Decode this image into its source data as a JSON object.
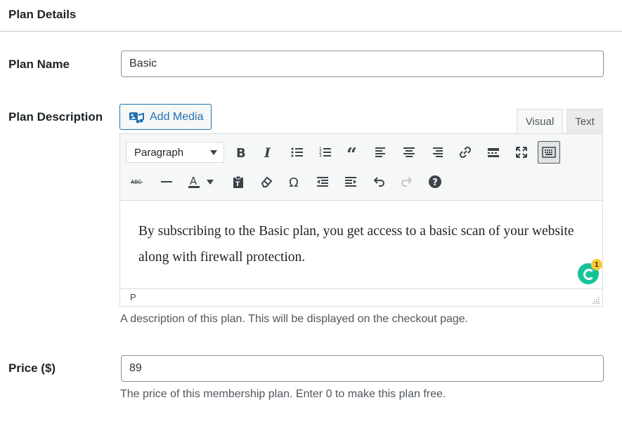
{
  "section": {
    "title": "Plan Details"
  },
  "plan_name": {
    "label": "Plan Name",
    "value": "Basic"
  },
  "plan_description": {
    "label": "Plan Description",
    "add_media_label": "Add Media",
    "tabs": {
      "visual": "Visual",
      "text": "Text"
    },
    "format_select": "Paragraph",
    "content": "By subscribing to the Basic plan, you get access to a basic scan of your website along with firewall protection.",
    "status_path": "P",
    "grammarly_count": "1",
    "help_text": "A description of this plan. This will be displayed on the checkout page."
  },
  "price": {
    "label": "Price ($)",
    "value": "89",
    "help_text": "The price of this membership plan. Enter 0 to make this plan free."
  },
  "toolbar_icons": {
    "row1": [
      "bold-icon",
      "italic-icon",
      "bulleted-list-icon",
      "numbered-list-icon",
      "blockquote-icon",
      "align-left-icon",
      "align-center-icon",
      "align-right-icon",
      "link-icon",
      "read-more-icon",
      "fullscreen-icon",
      "toolbar-toggle-icon"
    ],
    "row2": [
      "strikethrough-icon",
      "horizontal-line-icon",
      "text-color-icon",
      "paste-text-icon",
      "clear-formatting-icon",
      "special-character-icon",
      "outdent-icon",
      "indent-icon",
      "undo-icon",
      "redo-icon",
      "help-icon"
    ]
  },
  "colors": {
    "accent": "#2271b1",
    "grammarly": "#15c39a",
    "badge": "#fcc934"
  }
}
